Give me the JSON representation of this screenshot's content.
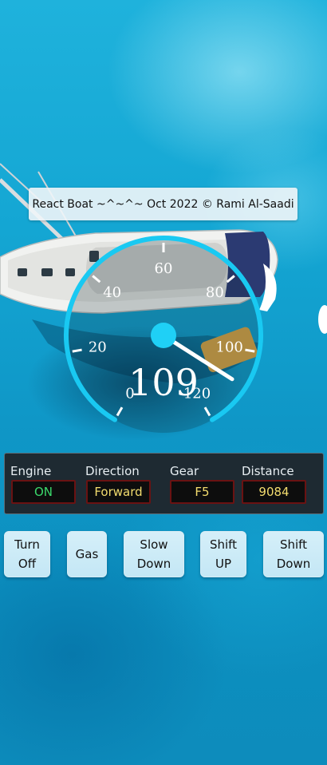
{
  "banner": {
    "text": "React Boat ~^~^~ Oct 2022 © Rami Al-Saadi"
  },
  "speedometer": {
    "speed": 109,
    "speed_text": "109",
    "min": 0,
    "max": 120,
    "tick_labels": [
      "0",
      "20",
      "40",
      "60",
      "80",
      "100",
      "120"
    ],
    "colors": {
      "arc": "#19c9f2",
      "hub": "#1fd0f6",
      "needle": "#ffffff",
      "text": "#ffffff"
    }
  },
  "dashboard": {
    "engine": {
      "label": "Engine",
      "value": "ON",
      "color": "#3bd96b"
    },
    "direction": {
      "label": "Direction",
      "value": "Forward",
      "color": "#f3dc6e"
    },
    "gear": {
      "label": "Gear",
      "value": "F5",
      "color": "#f3dc6e"
    },
    "distance": {
      "label": "Distance",
      "value": "9084",
      "color": "#f3dc6e"
    }
  },
  "controls": {
    "turn_off": {
      "line1": "Turn",
      "line2": "Off"
    },
    "gas": {
      "label": "Gas"
    },
    "slow_down": {
      "line1": "Slow",
      "line2": "Down"
    },
    "shift_up": {
      "line1": "Shift",
      "line2": "UP"
    },
    "shift_down": {
      "line1": "Shift",
      "line2": "Down"
    }
  }
}
